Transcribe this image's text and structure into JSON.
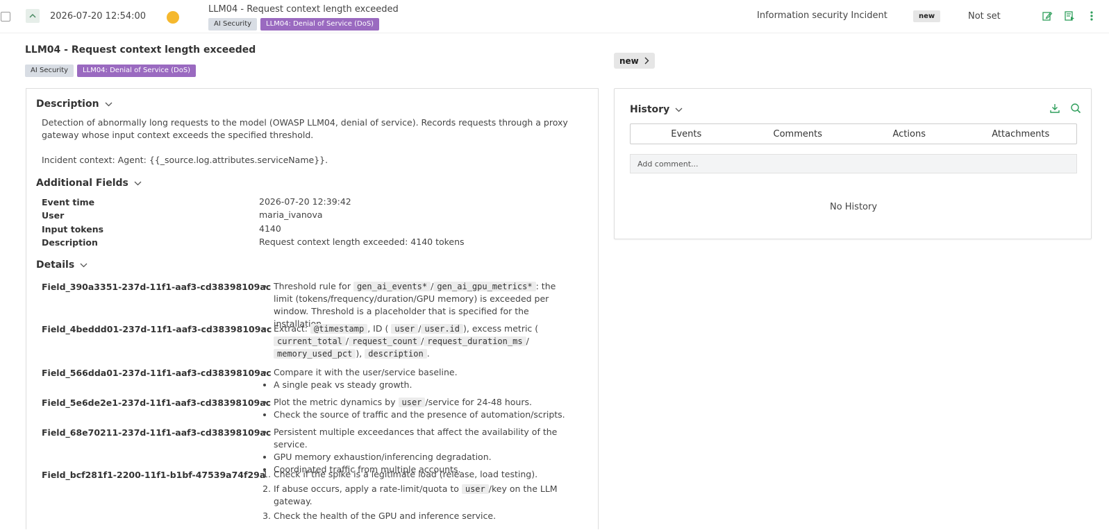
{
  "row": {
    "date": "2026-07-20 12:54:00",
    "title": "LLM04 - Request context length exceeded",
    "tags": [
      "AI Security",
      "LLM04: Denial of Service (DoS)"
    ],
    "category": "Information security Incident",
    "status": "new",
    "assignee": "Not set"
  },
  "detail": {
    "title": "LLM04 - Request context length exceeded",
    "tags": [
      "AI Security",
      "LLM04: Denial of Service (DoS)"
    ],
    "description_heading": "Description",
    "description_text": "Detection of abnormally long requests to the model (OWASP LLM04, denial of service). Records requests through a proxy gateway whose input context exceeds the specified threshold.",
    "context_text": "Incident context: Agent: {{_source.log.attributes.serviceName}}.",
    "additional_heading": "Additional Fields",
    "fields": [
      {
        "label": "Event time",
        "value": "2026-07-20 12:39:42"
      },
      {
        "label": "User",
        "value": "maria_ivanova"
      },
      {
        "label": "Input tokens",
        "value": "4140"
      },
      {
        "label": "Description",
        "value": "Request context length exceeded: 4140 tokens"
      }
    ],
    "details_heading": "Details",
    "details": [
      {
        "key": "Field_390a3351-237d-11f1-aaf3-cd38398109ac"
      },
      {
        "key": "Field_4beddd01-237d-11f1-aaf3-cd38398109ac"
      },
      {
        "key": "Field_566dda01-237d-11f1-aaf3-cd38398109ac"
      },
      {
        "key": "Field_5e6de2e1-237d-11f1-aaf3-cd38398109ac"
      },
      {
        "key": "Field_68e70211-237d-11f1-aaf3-cd38398109ac"
      },
      {
        "key": "Field_bcf281f1-2200-11f1-b1bf-47539a74f29a"
      }
    ],
    "d0": {
      "pre": "Threshold rule for",
      "c1": "gen_ai_events*",
      "sep": "/",
      "c2": "gen_ai_gpu_metrics*",
      "post": ": the limit (tokens/frequency/duration/GPU memory) is exceeded per window. Threshold is a placeholder that is specified for the installation."
    },
    "d1": {
      "pre": "Extract:",
      "c1": "@timestamp",
      "mid1": ", ID (",
      "c2": "user",
      "sep": "/",
      "c3": "user.id",
      "mid2": "), excess metric (",
      "c4": "current_total",
      "c5": "request_count",
      "c6": "request_duration_ms",
      "c7": "memory_used_pct",
      "mid3": "),",
      "c8": "description",
      "end": "."
    },
    "d2": [
      "Compare it with the user/service baseline.",
      "A single peak vs steady growth."
    ],
    "d3": {
      "a_pre": "Plot the metric dynamics by",
      "a_code": "user",
      "a_post": "/service for 24-48 hours.",
      "b": "Check the source of traffic and the presence of automation/scripts."
    },
    "d4": [
      "Persistent multiple exceedances that affect the availability of the service.",
      "GPU memory exhaustion/inferencing degradation.",
      "Coordinated traffic from multiple accounts."
    ],
    "d5": {
      "a": "Check if the spike is a legitimate load (release, load testing).",
      "b_pre": "If abuse occurs, apply a rate-limit/quota to",
      "b_code": "user",
      "b_post": "/key on the LLM gateway.",
      "c": "Check the health of the GPU and inference service."
    }
  },
  "right": {
    "status_button": "new",
    "history_heading": "History",
    "tabs": [
      "Events",
      "Comments",
      "Actions",
      "Attachments"
    ],
    "comment_placeholder": "Add comment...",
    "empty": "No History"
  },
  "colors": {
    "accent": "#2e9e5b",
    "purple": "#9a6ac0",
    "dot": "#f5b82e"
  }
}
